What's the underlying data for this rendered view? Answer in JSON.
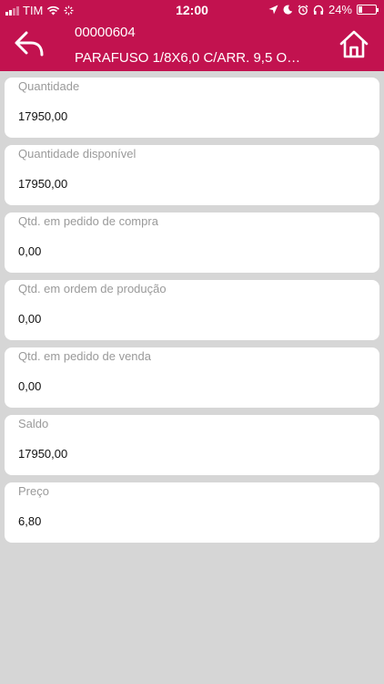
{
  "statusbar": {
    "carrier": "TIM",
    "time": "12:00",
    "battery": "24%",
    "battery_level": 0.24
  },
  "header": {
    "code": "00000604",
    "description": "PARAFUSO 1/8X6,0 C/ARR. 9,5 O…",
    "back_icon": "back-arrow-icon",
    "home_icon": "home-icon"
  },
  "fields": [
    {
      "label": "Quantidade",
      "value": "17950,00"
    },
    {
      "label": "Quantidade disponível",
      "value": "17950,00"
    },
    {
      "label": "Qtd. em pedido de compra",
      "value": "0,00"
    },
    {
      "label": "Qtd. em ordem de produção",
      "value": "0,00"
    },
    {
      "label": "Qtd. em pedido de venda",
      "value": "0,00"
    },
    {
      "label": "Saldo",
      "value": "17950,00"
    },
    {
      "label": "Preço",
      "value": "6,80"
    }
  ],
  "colors": {
    "primary": "#c2124f",
    "background": "#d6d6d6"
  }
}
